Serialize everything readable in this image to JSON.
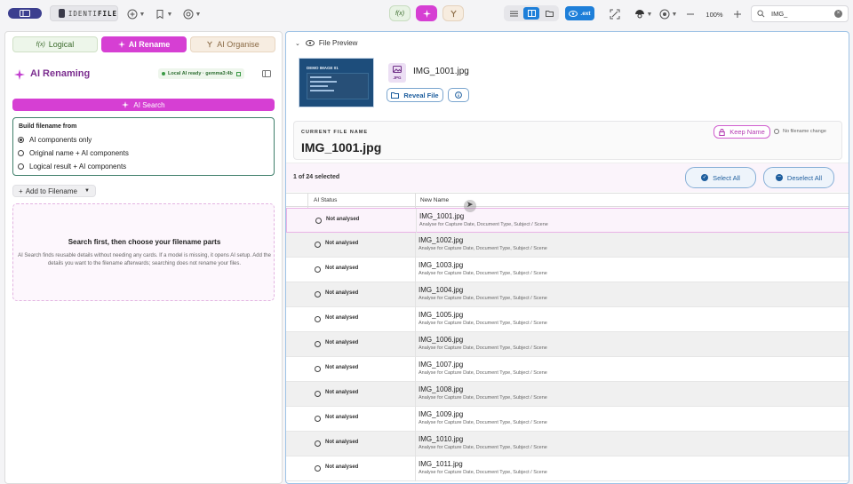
{
  "toolbar": {
    "app_name_left": "IDENTI",
    "app_name_right": "FILE",
    "func_label": "f(x)",
    "ext_label": ".ext",
    "zoom": "100%",
    "search_value": "IMG_"
  },
  "left": {
    "tabs": [
      "Logical",
      "AI Rename",
      "AI Organise"
    ],
    "title": "AI Renaming",
    "ai_status": "Local AI ready · gemma3:4b",
    "search_btn": "AI Search",
    "build_heading": "Build filename from",
    "options": [
      "AI components only",
      "Original name + AI components",
      "Logical result + AI components"
    ],
    "add_btn": "Add to Filename",
    "empty_title": "Search first, then choose your filename parts",
    "empty_text": "AI Search finds reusable details without needing any cards. If a model is missing, it opens AI setup. Add the details you want to the filename afterwards; searching does not rename your files."
  },
  "preview": {
    "header": "File Preview",
    "thumb_title": "DEMO IMAGE 01",
    "file_type": "JPG",
    "file_name": "IMG_1001.jpg",
    "reveal_btn": "Reveal File",
    "current_label": "CURRENT FILE NAME",
    "current_name": "IMG_1001.jpg",
    "keep_btn": "Keep Name",
    "no_change": "No filename change"
  },
  "list": {
    "selected_text": "1 of 24 selected",
    "select_all": "Select All",
    "deselect_all": "Deselect All",
    "col_status": "AI Status",
    "col_name": "New Name",
    "rows": [
      {
        "status": "Not analysed",
        "name": "IMG_1001.jpg",
        "sub": "Analyse for Capture Date, Document Type, Subject / Scene"
      },
      {
        "status": "Not analysed",
        "name": "IMG_1002.jpg",
        "sub": "Analyse for Capture Date, Document Type, Subject / Scene"
      },
      {
        "status": "Not analysed",
        "name": "IMG_1003.jpg",
        "sub": "Analyse for Capture Date, Document Type, Subject / Scene"
      },
      {
        "status": "Not analysed",
        "name": "IMG_1004.jpg",
        "sub": "Analyse for Capture Date, Document Type, Subject / Scene"
      },
      {
        "status": "Not analysed",
        "name": "IMG_1005.jpg",
        "sub": "Analyse for Capture Date, Document Type, Subject / Scene"
      },
      {
        "status": "Not analysed",
        "name": "IMG_1006.jpg",
        "sub": "Analyse for Capture Date, Document Type, Subject / Scene"
      },
      {
        "status": "Not analysed",
        "name": "IMG_1007.jpg",
        "sub": "Analyse for Capture Date, Document Type, Subject / Scene"
      },
      {
        "status": "Not analysed",
        "name": "IMG_1008.jpg",
        "sub": "Analyse for Capture Date, Document Type, Subject / Scene"
      },
      {
        "status": "Not analysed",
        "name": "IMG_1009.jpg",
        "sub": "Analyse for Capture Date, Document Type, Subject / Scene"
      },
      {
        "status": "Not analysed",
        "name": "IMG_1010.jpg",
        "sub": "Analyse for Capture Date, Document Type, Subject / Scene"
      },
      {
        "status": "Not analysed",
        "name": "IMG_1011.jpg",
        "sub": "Analyse for Capture Date, Document Type, Subject / Scene"
      }
    ]
  },
  "colors": {
    "accent": "#d63fd3",
    "blue": "#1e7fd9",
    "navy": "#3c3f8f"
  },
  "icons": [
    "panel-icon",
    "logo-icon",
    "add-icon",
    "bookmark-icon",
    "at-icon",
    "function-icon",
    "sparkle-icon",
    "merge-icon",
    "list-icon",
    "grid-icon",
    "folder-icon",
    "eye-icon",
    "scan-icon",
    "ai-icon",
    "settings-icon",
    "minus-icon",
    "plus-icon",
    "search-icon",
    "clear-icon"
  ]
}
